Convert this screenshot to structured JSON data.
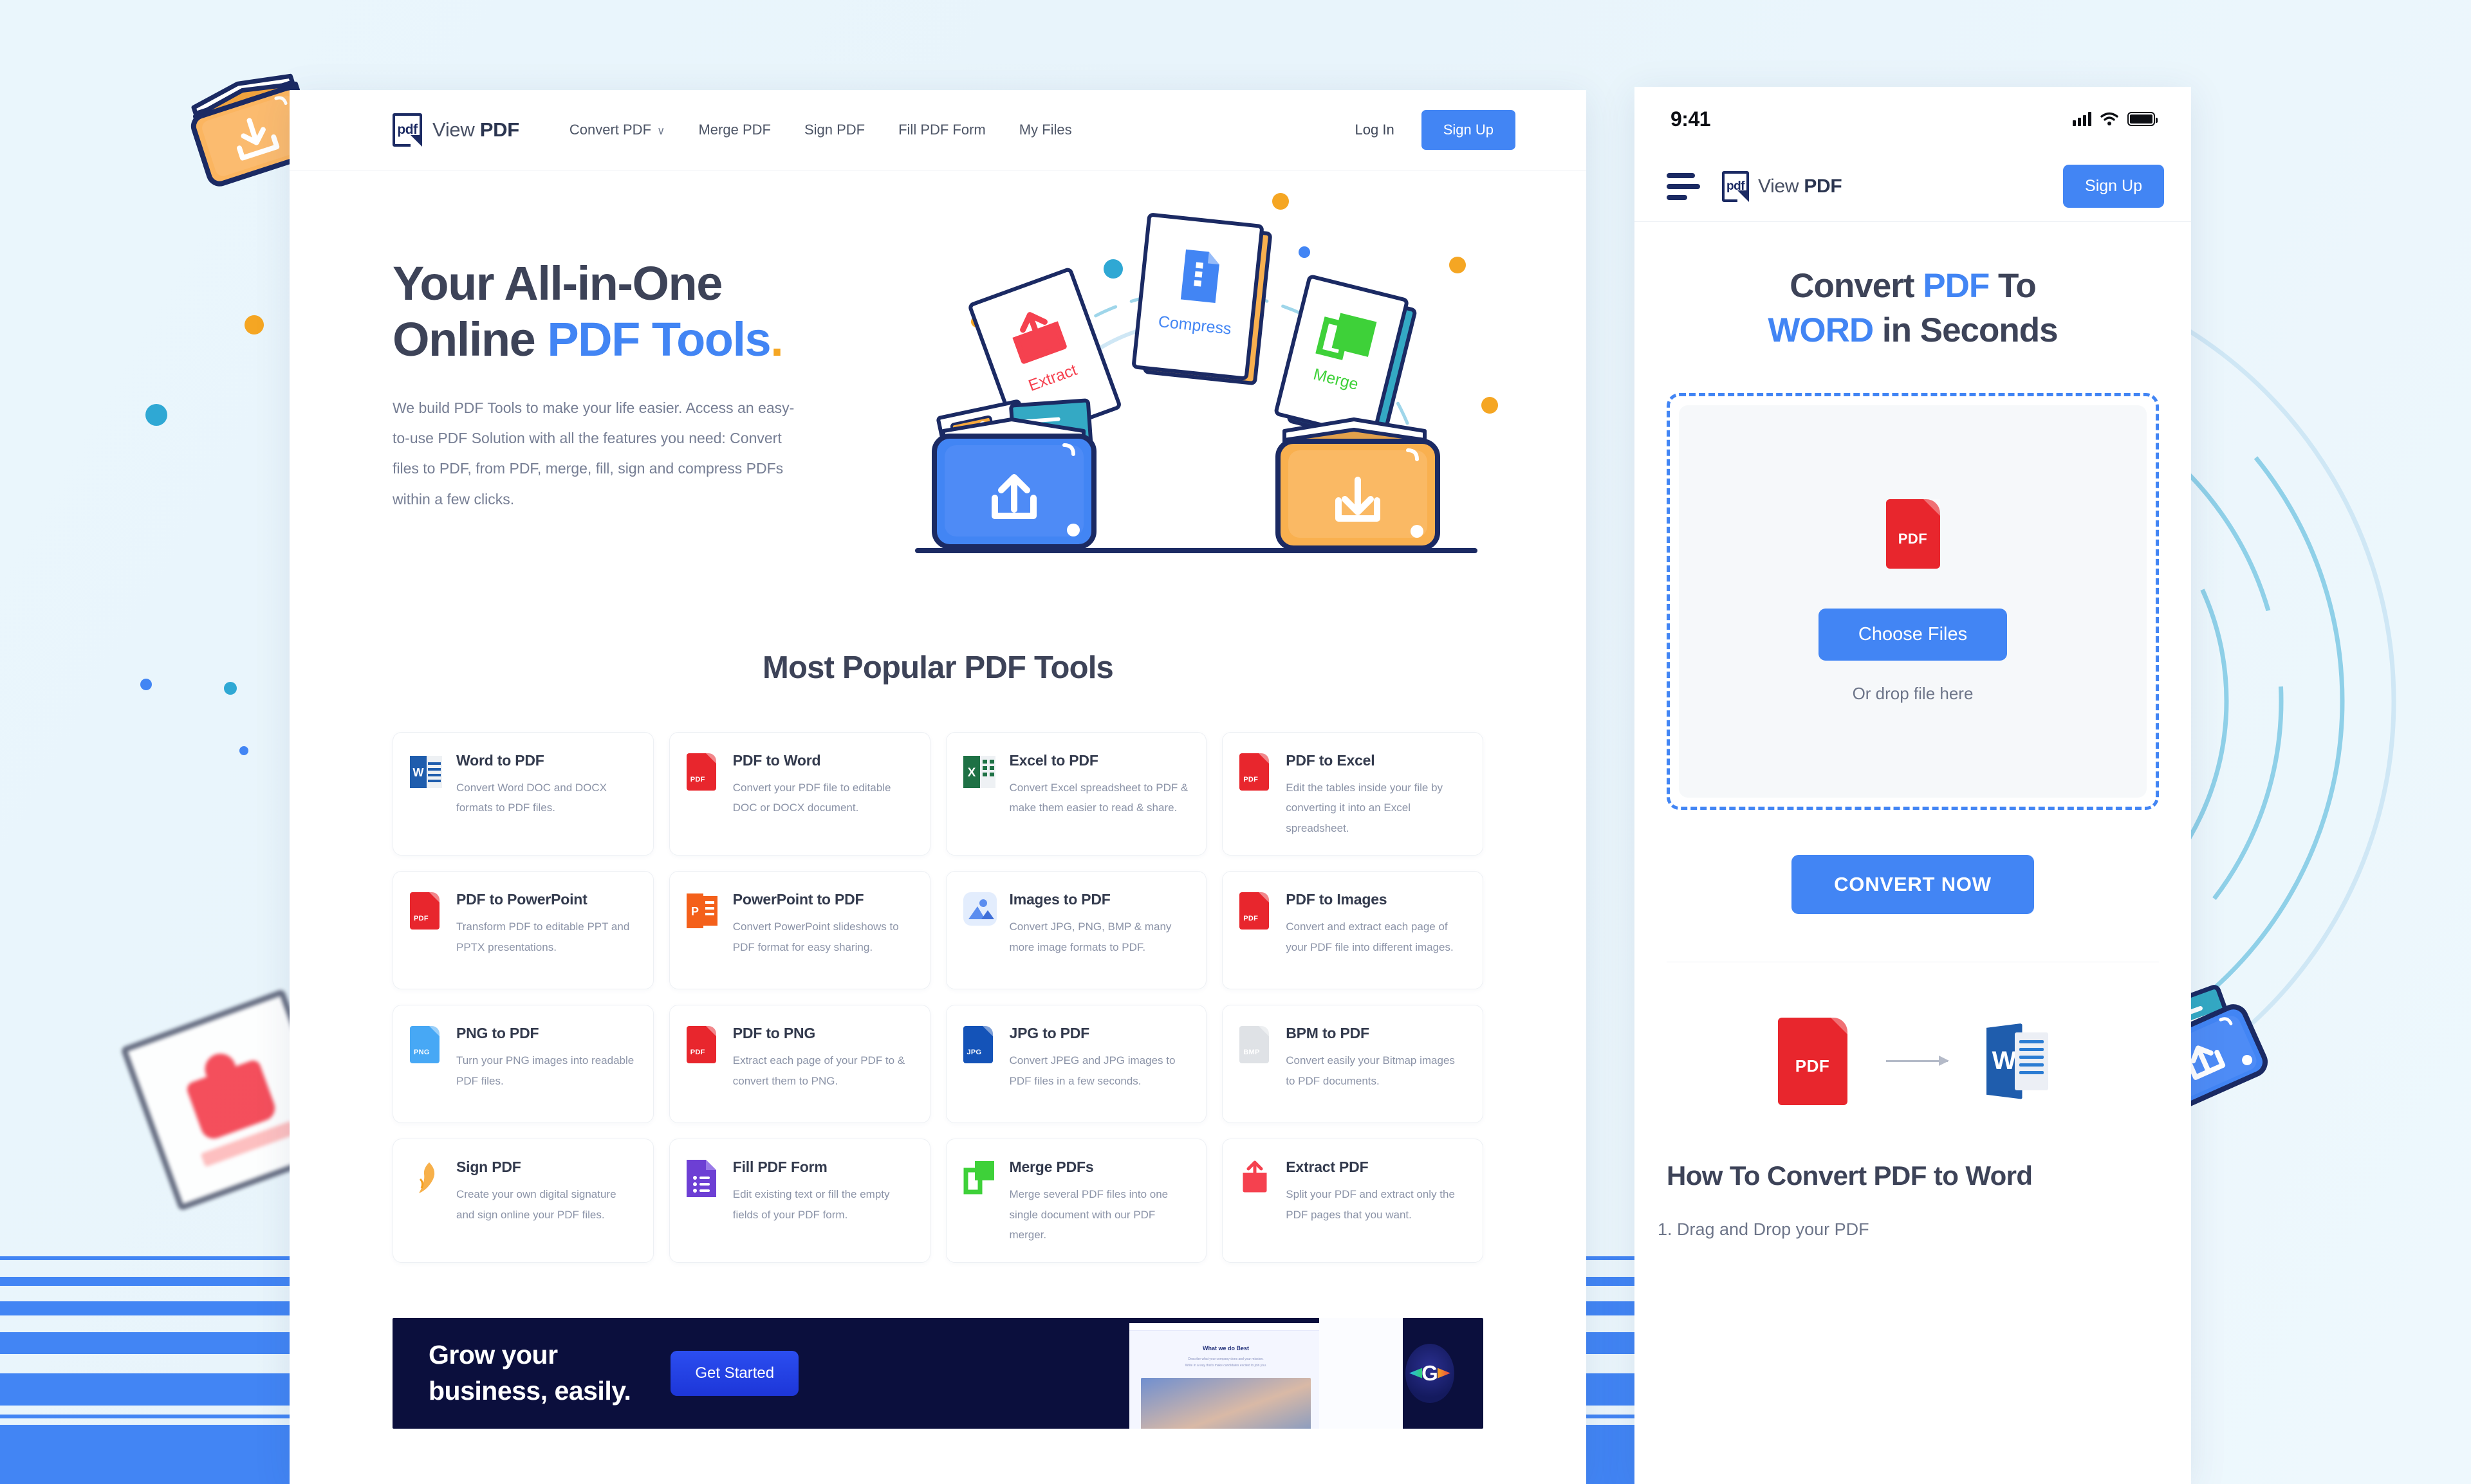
{
  "colors": {
    "accent_blue": "#4285f4",
    "navy": "#1b2a63",
    "heading": "#3d4358",
    "body_text": "#8b93a7",
    "orange": "#f5a623",
    "banner_bg": "#0b0f3d",
    "pdf_red": "#e8262d",
    "page_bg": "#eaf6fc"
  },
  "desktop": {
    "nav": {
      "logo_mark_text": "pdf",
      "logo_text_light": "View ",
      "logo_text_bold": "PDF",
      "links": [
        {
          "label": "Convert PDF",
          "has_dropdown": true,
          "chevron": "∨"
        },
        {
          "label": "Merge PDF",
          "has_dropdown": false
        },
        {
          "label": "Sign PDF",
          "has_dropdown": false
        },
        {
          "label": "Fill PDF Form",
          "has_dropdown": false
        },
        {
          "label": "My Files",
          "has_dropdown": false
        }
      ],
      "login_label": "Log In",
      "signup_label": "Sign Up"
    },
    "hero": {
      "heading_line1": "Your All-in-One",
      "heading_line2_plain": "Online ",
      "heading_line2_accent": "PDF Tools",
      "heading_period": ".",
      "paragraph": "We build PDF Tools to make your life easier. Access an easy-to-use PDF Solution with all the features you need: Convert files to PDF, from PDF, merge, fill, sign and compress PDFs within a few clicks.",
      "illustration": {
        "card_labels": [
          "Extract",
          "Compress",
          "Merge"
        ],
        "upload_folder_color": "#4285f4",
        "download_folder_color": "#f9b04f"
      }
    },
    "tools_section": {
      "title": "Most Popular PDF Tools",
      "cards": [
        {
          "title": "Word to PDF",
          "desc": "Convert Word DOC and DOCX formats to PDF files.",
          "icon": "word-file-icon",
          "icon_tag": "W",
          "icon_color": "#1f5dad"
        },
        {
          "title": "PDF to Word",
          "desc": "Convert your PDF file to editable DOC or DOCX document.",
          "icon": "pdf-file-icon",
          "icon_tag": "PDF",
          "icon_color": "#e8262d"
        },
        {
          "title": "Excel to PDF",
          "desc": "Convert Excel spreadsheet to PDF & make them easier to read & share.",
          "icon": "excel-file-icon",
          "icon_tag": "X",
          "icon_color": "#1e7145"
        },
        {
          "title": "PDF to Excel",
          "desc": "Edit the tables inside your file by converting it into an Excel spreadsheet.",
          "icon": "pdf-file-icon",
          "icon_tag": "PDF",
          "icon_color": "#e8262d"
        },
        {
          "title": "PDF to PowerPoint",
          "desc": "Transform PDF to editable PPT and PPTX presentations.",
          "icon": "pdf-file-icon",
          "icon_tag": "PDF",
          "icon_color": "#e8262d"
        },
        {
          "title": "PowerPoint to PDF",
          "desc": "Convert PowerPoint slideshows to PDF format for easy sharing.",
          "icon": "powerpoint-file-icon",
          "icon_tag": "P",
          "icon_color": "#f4601a"
        },
        {
          "title": "Images to PDF",
          "desc": "Convert JPG, PNG, BMP & many more image formats to PDF.",
          "icon": "image-icon",
          "icon_tag": "",
          "icon_color": "#5b8def"
        },
        {
          "title": "PDF to Images",
          "desc": "Convert and extract each page of your PDF file into different images.",
          "icon": "pdf-file-icon",
          "icon_tag": "PDF",
          "icon_color": "#e8262d"
        },
        {
          "title": "PNG to PDF",
          "desc": "Turn your PNG images into readable PDF files.",
          "icon": "png-file-icon",
          "icon_tag": "PNG",
          "icon_color": "#47a8f5"
        },
        {
          "title": "PDF to PNG",
          "desc": "Extract each page of your PDF to & convert them to PNG.",
          "icon": "pdf-file-icon",
          "icon_tag": "PDF",
          "icon_color": "#e8262d"
        },
        {
          "title": "JPG to PDF",
          "desc": "Convert JPEG and JPG images to PDF files in a few seconds.",
          "icon": "jpg-file-icon",
          "icon_tag": "JPG",
          "icon_color": "#1453b8"
        },
        {
          "title": "BPM to PDF",
          "desc": "Convert easily your Bitmap images to PDF documents.",
          "icon": "bmp-file-icon",
          "icon_tag": "BMP",
          "icon_color": "#dfe2e6"
        },
        {
          "title": "Sign PDF",
          "desc": "Create your own digital signature and sign online your PDF files.",
          "icon": "signature-pen-icon",
          "icon_tag": "",
          "icon_color": "#f5a623"
        },
        {
          "title": "Fill PDF Form",
          "desc": "Edit existing text or fill the empty fields of your PDF form.",
          "icon": "form-file-icon",
          "icon_tag": "",
          "icon_color": "#6d3fd4"
        },
        {
          "title": "Merge PDFs",
          "desc": "Merge several PDF files into one single document with our PDF merger.",
          "icon": "merge-icon",
          "icon_tag": "",
          "icon_color": "#3ed139"
        },
        {
          "title": "Extract PDF",
          "desc": "Split your PDF and extract only the PDF pages that you want.",
          "icon": "extract-icon",
          "icon_tag": "",
          "icon_color": "#f5414f"
        }
      ]
    },
    "banner": {
      "heading_line1": "Grow your",
      "heading_line2": "business, easily.",
      "cta_label": "Get Started",
      "mock_title": "What we do Best",
      "mock_sub_line1": "Describe what your company does and your mission.",
      "mock_sub_line2": "Write in a way that's make candidates excited to join you.",
      "logo_letter": "G"
    }
  },
  "mobile": {
    "status": {
      "time": "9:41",
      "signal": "signal-bars-icon",
      "wifi": "wifi-icon",
      "battery": "battery-full-icon"
    },
    "nav": {
      "menu": "hamburger-menu-icon",
      "logo_mark_text": "pdf",
      "logo_text_light": "View ",
      "logo_text_bold": "PDF",
      "signup_label": "Sign Up"
    },
    "hero": {
      "line1_plain": "Convert ",
      "line1_accent": "PDF",
      "line1_tail": " To",
      "line2_accent": "WORD",
      "line2_tail": " in Seconds"
    },
    "dropzone": {
      "file_glyph_label": "PDF",
      "choose_label": "Choose Files",
      "drop_hint": "Or drop file here"
    },
    "convert_label": "CONVERT NOW",
    "how_section": {
      "title": "How To Convert PDF to Word",
      "steps": [
        "Drag and Drop your PDF"
      ],
      "art": {
        "from": "pdf-file-icon",
        "to": "word-file-icon",
        "arrow": "arrow-right-icon",
        "word_letter": "W"
      }
    }
  }
}
